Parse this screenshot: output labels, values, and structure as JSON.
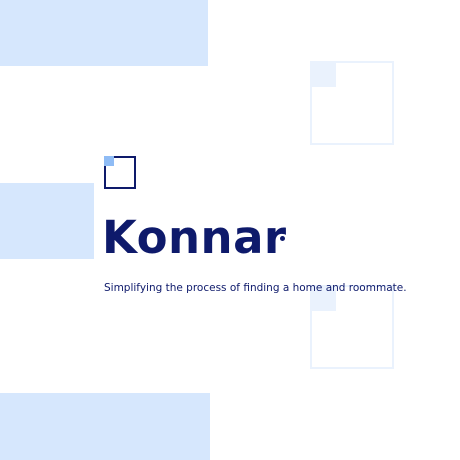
{
  "brand": {
    "name": "Konnar",
    "tagline": "Simplifying the process of finding a home and roommate."
  },
  "colors": {
    "brand_navy": "#0e1a6b",
    "accent_blue": "#8fbcf5",
    "light_block": "#d6e7fd",
    "faint_outline": "#eaf2fd",
    "background": "#ffffff"
  }
}
